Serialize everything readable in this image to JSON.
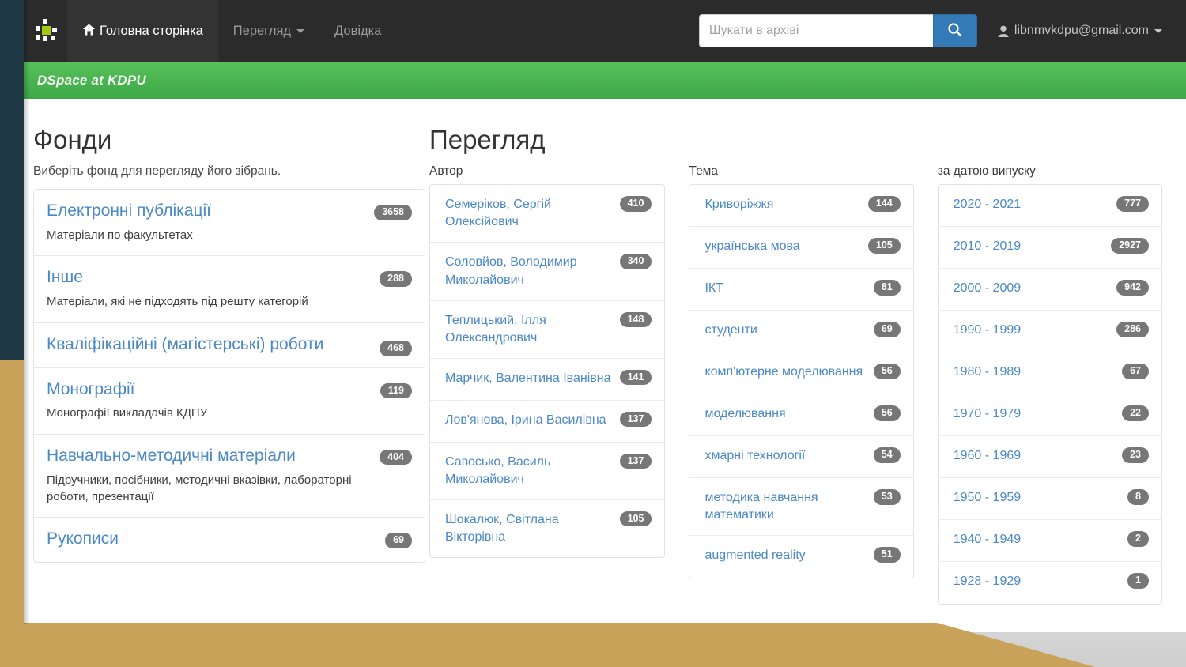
{
  "navbar": {
    "logo_name": "dspace-logo",
    "items": [
      {
        "label": "Головна сторінка",
        "icon": "home-icon",
        "active": true,
        "caret": false
      },
      {
        "label": "Перегляд",
        "icon": "",
        "active": false,
        "caret": true
      },
      {
        "label": "Довідка",
        "icon": "",
        "active": false,
        "caret": false
      }
    ],
    "search": {
      "placeholder": "Шукати в архіві",
      "value": "",
      "button_icon": "search-icon"
    },
    "user": {
      "label": "libnmvkdpu@gmail.com",
      "icon": "user-icon",
      "caret": true
    }
  },
  "banner": {
    "title": "DSpace at KDPU",
    "color": "#3fa847"
  },
  "communities": {
    "title": "Фонди",
    "subtitle": "Виберіть фонд для перегляду його зібрань.",
    "items": [
      {
        "name": "Електронні публікації",
        "count": "3658",
        "description": "Матеріали по факультетах",
        "badge_low": false
      },
      {
        "name": "Інше",
        "count": "288",
        "description": "Матеріали, які не підходять під решту категорій",
        "badge_low": false
      },
      {
        "name": "Кваліфікаційні (магістерські) роботи",
        "count": "468",
        "description": "",
        "badge_low": true
      },
      {
        "name": "Монографії",
        "count": "119",
        "description": "Монографії викладачів КДПУ",
        "badge_low": false
      },
      {
        "name": "Навчально-методичні матеріали",
        "count": "404",
        "description": "Підручники, посібники, методичні вказівки, лабораторні роботи, презентації",
        "badge_low": false
      },
      {
        "name": "Рукописи",
        "count": "69",
        "description": "",
        "badge_low": false
      }
    ]
  },
  "browse": {
    "title": "Перегляд",
    "columns": [
      {
        "label": "Автор",
        "rows": [
          {
            "label": "Семеріков, Сергій Олексійович",
            "count": "410"
          },
          {
            "label": "Соловйов, Володимир Миколайович",
            "count": "340"
          },
          {
            "label": "Теплицький, Ілля Олександрович",
            "count": "148"
          },
          {
            "label": "Марчик, Валентина Іванівна",
            "count": "141"
          },
          {
            "label": "Лов'янова, Ірина Василівна",
            "count": "137"
          },
          {
            "label": "Савосько, Василь Миколайович",
            "count": "137"
          },
          {
            "label": "Шокалюк, Світлана Вікторівна",
            "count": "105"
          }
        ]
      },
      {
        "label": "Тема",
        "rows": [
          {
            "label": "Криворіжжя",
            "count": "144"
          },
          {
            "label": "українська мова",
            "count": "105"
          },
          {
            "label": "ІКТ",
            "count": "81"
          },
          {
            "label": "студенти",
            "count": "69"
          },
          {
            "label": "комп'ютерне моделювання",
            "count": "56"
          },
          {
            "label": "моделювання",
            "count": "56"
          },
          {
            "label": "хмарні технології",
            "count": "54"
          },
          {
            "label": "методика навчання математики",
            "count": "53"
          },
          {
            "label": "augmented reality",
            "count": "51"
          }
        ]
      },
      {
        "label": "за датою випуску",
        "rows": [
          {
            "label": "2020 - 2021",
            "count": "777"
          },
          {
            "label": "2010 - 2019",
            "count": "2927"
          },
          {
            "label": "2000 - 2009",
            "count": "942"
          },
          {
            "label": "1990 - 1999",
            "count": "286"
          },
          {
            "label": "1980 - 1989",
            "count": "67"
          },
          {
            "label": "1970 - 1979",
            "count": "22"
          },
          {
            "label": "1960 - 1969",
            "count": "23"
          },
          {
            "label": "1950 - 1959",
            "count": "8"
          },
          {
            "label": "1940 - 1949",
            "count": "2"
          },
          {
            "label": "1928 - 1929",
            "count": "1"
          }
        ]
      }
    ]
  },
  "colors": {
    "navbar": "#2b2b2b",
    "banner_green": "#3fa847",
    "link_blue": "#4a88c7",
    "badge_grey": "#777777",
    "search_button": "#337ab7",
    "deco_navy": "#1f3944",
    "deco_gold": "#c9a359"
  }
}
